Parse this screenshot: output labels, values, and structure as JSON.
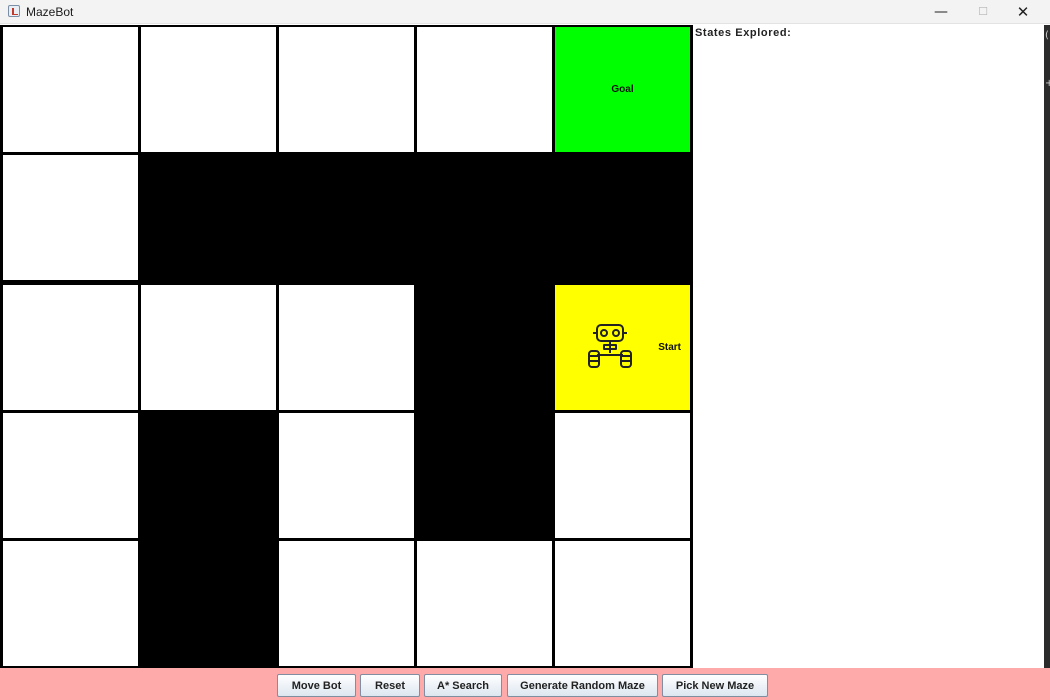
{
  "window": {
    "title": "MazeBot",
    "icon": "java-cup-icon",
    "controls": [
      "minimize",
      "maximize",
      "close"
    ]
  },
  "maze": {
    "rows": 5,
    "cols": 5,
    "wall_color": "#000000",
    "open_color": "#ffffff",
    "goal_color": "#00ff00",
    "start_color": "#ffff00",
    "grid": [
      [
        "open",
        "open",
        "open",
        "open",
        "goal"
      ],
      [
        "open",
        "wall",
        "wall",
        "wall",
        "wall"
      ],
      [
        "open",
        "open",
        "open",
        "wall",
        "start"
      ],
      [
        "open",
        "wall",
        "open",
        "wall",
        "open"
      ],
      [
        "open",
        "wall",
        "open",
        "open",
        "open"
      ]
    ],
    "goal_label": "Goal",
    "start_label": "Start",
    "bot_icon": "robot-icon"
  },
  "side_panel": {
    "title": "States Explored:"
  },
  "toolbar": {
    "background": "#ffaaaa",
    "move_bot": "Move Bot",
    "reset": "Reset",
    "astar": "A* Search",
    "generate": "Generate Random Maze",
    "pick": "Pick New Maze"
  }
}
